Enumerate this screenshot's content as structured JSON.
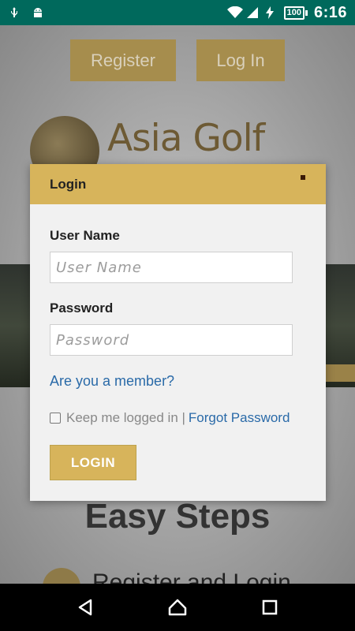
{
  "status_bar": {
    "icons": [
      "usb-icon",
      "android-icon",
      "wifi-icon",
      "signal-icon",
      "charging-icon"
    ],
    "battery": "100",
    "time": "6:16"
  },
  "background_page": {
    "register_label": "Register",
    "login_label": "Log In",
    "logo_text": "Asia Golf",
    "section_heading": "Easy Steps",
    "step_text": "Register and Login"
  },
  "modal": {
    "title": "Login",
    "username_label": "User Name",
    "username_placeholder": "User Name",
    "username_value": "",
    "password_label": "Password",
    "password_placeholder": "Password",
    "password_value": "",
    "member_link": "Are you a member?",
    "keep_logged_in": "Keep me logged in |",
    "forgot_password": "Forgot Password",
    "submit_label": "LOGIN"
  },
  "colors": {
    "status_bar": "#00695c",
    "accent_gold": "#d7b45b",
    "link_blue": "#2a6aa8"
  }
}
